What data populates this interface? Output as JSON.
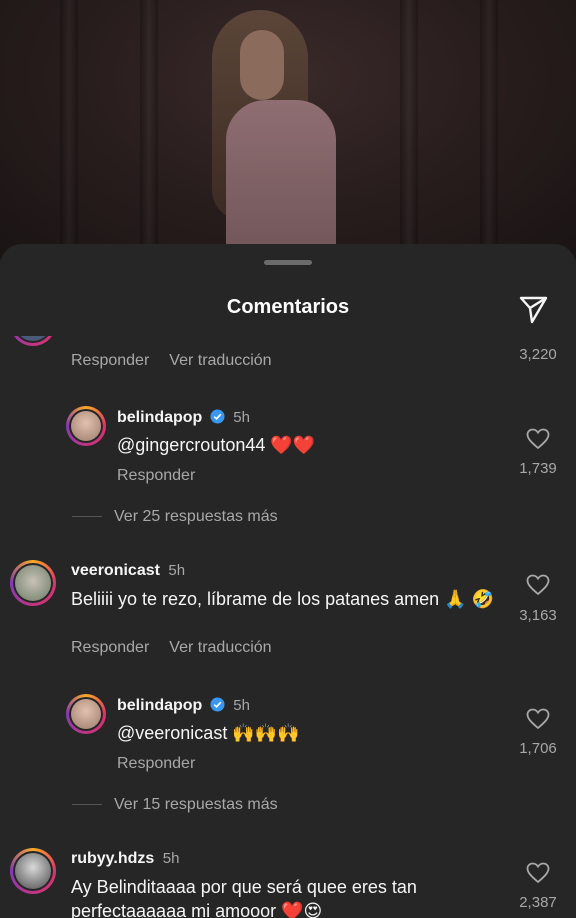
{
  "sheet": {
    "title": "Comentarios"
  },
  "top_partial": {
    "reply_label": "Responder",
    "translate_label": "Ver traducción",
    "likes": "3,220"
  },
  "comments": [
    {
      "username": "belindapop",
      "time": "5h",
      "text": "@gingercrouton44 ❤️❤️",
      "reply_label": "Responder",
      "likes": "1,739",
      "more_replies": "Ver 25 respuestas más"
    },
    {
      "username": "veeronicast",
      "time": "5h",
      "text": "Beliiii yo te rezo, líbrame de los patanes amen 🙏 🤣",
      "reply_label": "Responder",
      "translate_label": "Ver traducción",
      "likes": "3,163"
    },
    {
      "username": "belindapop",
      "time": "5h",
      "text": "@veeronicast 🙌🙌🙌",
      "reply_label": "Responder",
      "likes": "1,706",
      "more_replies": "Ver 15 respuestas más"
    },
    {
      "username": "rubyy.hdzs",
      "time": "5h",
      "text": "Ay Belinditaaaa por que será quee eres tan perfectaaaaaa mi amooor ❤️😍",
      "likes": "2,387"
    }
  ],
  "colors": {
    "background": "#262626",
    "secondary_text": "#a8a8a8",
    "verified": "#3897f0"
  }
}
